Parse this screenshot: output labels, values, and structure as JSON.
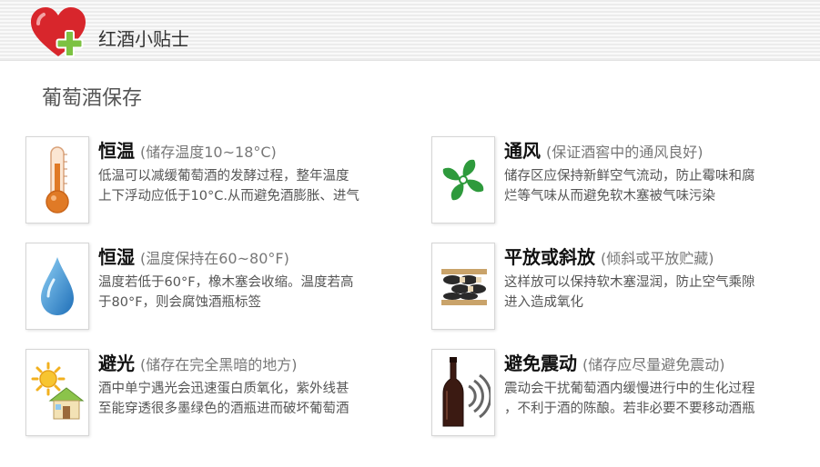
{
  "header": {
    "title": "红酒小贴士"
  },
  "section_title": "葡萄酒保存",
  "cards": [
    {
      "icon": "thermometer-icon",
      "title": "恒温",
      "subtitle": "(储存温度10~18°C)",
      "body": "低温可以减缓葡萄酒的发酵过程，整年温度\n上下浮动应低于10°C.从而避免酒膨胀、进气"
    },
    {
      "icon": "fan-icon",
      "title": "通风",
      "subtitle": "(保证酒窖中的通风良好)",
      "body": "储存区应保持新鲜空气流动，防止霉味和腐\n烂等气味从而避免软木塞被气味污染"
    },
    {
      "icon": "water-drop-icon",
      "title": "恒湿",
      "subtitle": "(温度保持在60~80°F)",
      "body": "温度若低于60°F，橡木塞会收缩。温度若高\n于80°F，则会腐蚀酒瓶标签"
    },
    {
      "icon": "wine-rack-icon",
      "title": "平放或斜放",
      "subtitle": "(倾斜或平放贮藏)",
      "body": "  这样放可以保持软木塞湿润，防止空气乘隙\n  进入造成氧化"
    },
    {
      "icon": "sun-house-icon",
      "title": "避光",
      "subtitle": "(储存在完全黑暗的地方)",
      "body": "酒中单宁遇光会迅速蛋白质氧化，紫外线甚\n至能穿透很多墨绿色的酒瓶进而破坏葡萄酒"
    },
    {
      "icon": "bottle-vibration-icon",
      "title": "避免震动",
      "subtitle": "(储存应尽量避免震动)",
      "body": "震动会干扰葡萄酒内缓慢进行中的生化过程\n，不利于酒的陈酿。若非必要不要移动酒瓶"
    }
  ],
  "colors": {
    "heart": "#d8262c",
    "cross": "#7cc242",
    "fan": "#2e9a3c",
    "drop": "#1f7fc9",
    "thermo": "#e07a26"
  }
}
